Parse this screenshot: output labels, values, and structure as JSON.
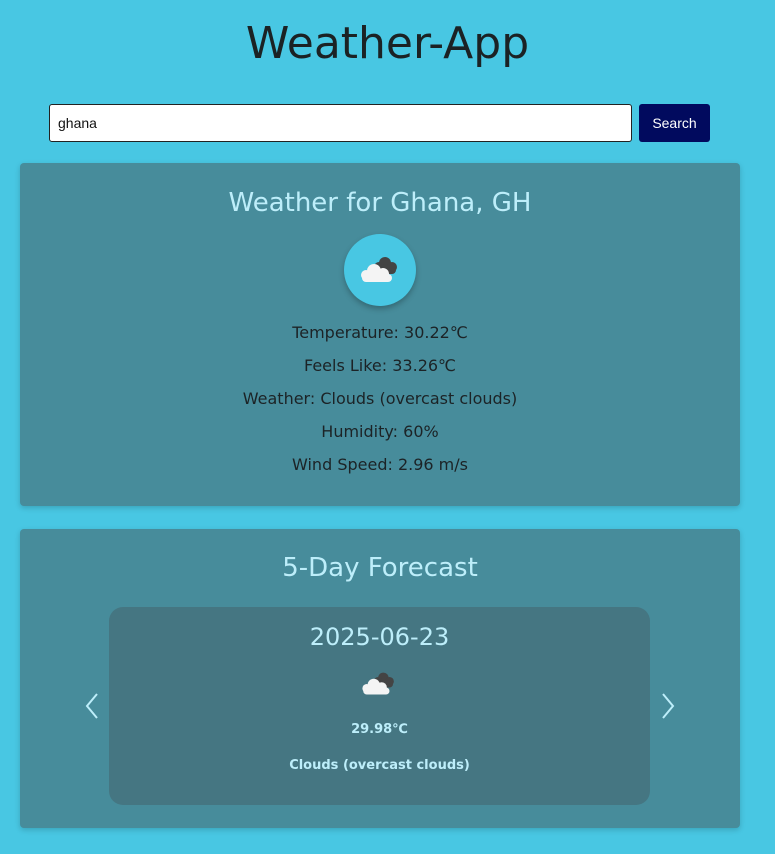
{
  "app": {
    "title": "Weather-App"
  },
  "search": {
    "value": "ghana",
    "placeholder": "",
    "button_label": "Search"
  },
  "current": {
    "title": "Weather for Ghana, GH",
    "icon": "clouds-icon",
    "temperature": "Temperature: 30.22℃",
    "feels_like": "Feels Like: 33.26℃",
    "weather": "Weather: Clouds (overcast clouds)",
    "humidity": "Humidity: 60%",
    "wind": "Wind Speed: 2.96 m/s"
  },
  "forecast": {
    "title": "5-Day Forecast",
    "slide": {
      "date": "2025-06-23",
      "icon": "clouds-icon",
      "temp": "29.98℃",
      "description": "Clouds (overcast clouds)"
    },
    "prev_icon": "chevron-left-icon",
    "next_icon": "chevron-right-icon"
  },
  "colors": {
    "background": "#48c7e3",
    "card": "#478c9b",
    "slide": "#457682",
    "accent_text": "#bdeefa",
    "button": "#010a5e"
  }
}
